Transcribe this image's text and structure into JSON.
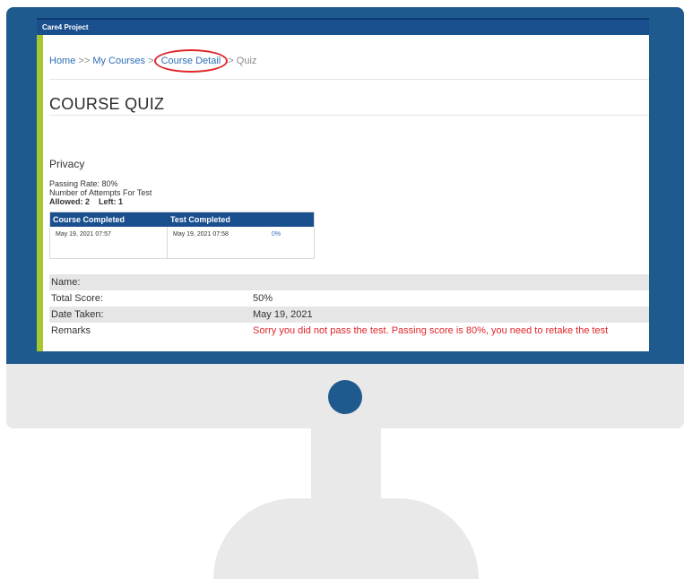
{
  "app": {
    "title": "Care4 Project"
  },
  "breadcrumb": {
    "home": "Home",
    "sep1": ">>",
    "my_courses": "My Courses",
    "sep2": ">",
    "course_detail": "Course Detail",
    "sep3": ">",
    "current": "Quiz"
  },
  "page": {
    "title": "COURSE QUIZ"
  },
  "quiz": {
    "name": "Privacy",
    "passing_rate": "Passing Rate: 80%",
    "attempts_label": "Number of Attempts For Test",
    "allowed": "Allowed: 2",
    "left": "Left: 1"
  },
  "status_table": {
    "col1": "Course Completed",
    "col2": "Test Completed",
    "course_completed": "May 19, 2021 07:57",
    "test_completed": "May 19, 2021 07:58",
    "percent": "0%"
  },
  "results": {
    "name_label": "Name:",
    "name_value": "",
    "total_label": "Total Score:",
    "total_value": "50%",
    "date_label": "Date Taken:",
    "date_value": "May 19, 2021",
    "remarks_label": "Remarks",
    "remarks_value": "Sorry you did not pass the test. Passing score is 80%, you need to retake the test"
  },
  "colors": {
    "header": "#1a4f8e",
    "accent_bar": "#a7c72f",
    "link": "#2d6fb5",
    "error": "#e0262b",
    "monitor": "#1f5a8e"
  }
}
